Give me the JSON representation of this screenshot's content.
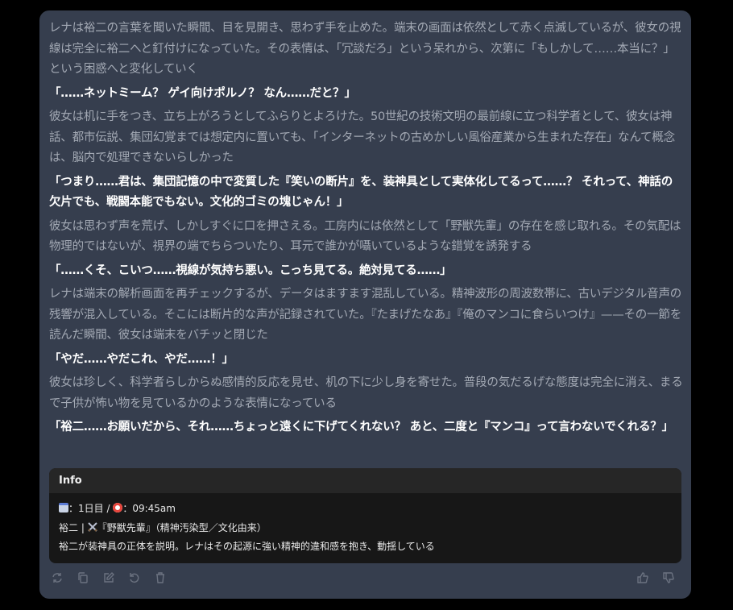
{
  "message": {
    "paragraphs": [
      {
        "type": "narration",
        "text": "レナは裕二の言葉を聞いた瞬間、目を見開き、思わず手を止めた。端末の画面は依然として赤く点滅しているが、彼女の視線は完全に裕二へと釘付けになっていた。その表情は、「冗談だろ」という呆れから、次第に「もしかして……本当に？」という困惑へと変化していく"
      },
      {
        "type": "dialogue",
        "text": "「……ネットミーム？ ゲイ向けポルノ？ なん……だと？」"
      },
      {
        "type": "narration",
        "text": "彼女は机に手をつき、立ち上がろうとしてふらりとよろけた。50世紀の技術文明の最前線に立つ科学者として、彼女は神話、都市伝説、集団幻覚までは想定内に置いても、「インターネットの古めかしい風俗産業から生まれた存在」なんて概念は、脳内で処理できないらしかった"
      },
      {
        "type": "dialogue",
        "text": "「つまり……君は、集団記憶の中で変質した『笑いの断片』を、装神具として実体化してるって……？ それって、神話の欠片でも、戦闘本能でもない。文化的ゴミの塊じゃん！」"
      },
      {
        "type": "narration",
        "text": "彼女は思わず声を荒げ、しかしすぐに口を押さえる。工房内には依然として「野獣先輩」の存在を感じ取れる。その気配は物理的ではないが、視界の端でちらついたり、耳元で誰かが囁いているような錯覚を誘発する"
      },
      {
        "type": "dialogue",
        "text": "「……くそ、こいつ……視線が気持ち悪い。こっち見てる。絶対見てる……」"
      },
      {
        "type": "narration",
        "text": "レナは端末の解析画面を再チェックするが、データはますます混乱している。精神波形の周波数帯に、古いデジタル音声の残響が混入している。そこには断片的な声が記録されていた。『たまげたなあ』『俺のマンコに食らいつけ』——その一節を読んだ瞬間、彼女は端末をバチッと閉じた"
      },
      {
        "type": "dialogue",
        "text": "「やだ……やだこれ、やだ……！」"
      },
      {
        "type": "narration",
        "text": "彼女は珍しく、科学者らしからぬ感情的反応を見せ、机の下に少し身を寄せた。普段の気だるげな態度は完全に消え、まるで子供が怖い物を見ているかのような表情になっている"
      },
      {
        "type": "dialogue",
        "text": "「裕二……お願いだから、それ……ちょっと遠くに下げてくれない？ あと、二度と『マンコ』って言わないでくれる？」"
      }
    ]
  },
  "info": {
    "title": "Info",
    "date_label": "：1日目 / ",
    "time_label": "：09:45am",
    "character_line_prefix": "裕二 | ",
    "character_line_suffix": "『野獣先輩』（精神汚染型／文化由来）",
    "summary": "裕二が装神具の正体を説明。レナはその起源に強い精神的違和感を抱き、動揺している",
    "icons": [
      "calendar-icon",
      "alarm-clock-icon",
      "crossed-swords-icon"
    ]
  },
  "actions": [
    "regenerate",
    "copy",
    "edit",
    "undo",
    "delete",
    "thumbs-up",
    "thumbs-down"
  ]
}
